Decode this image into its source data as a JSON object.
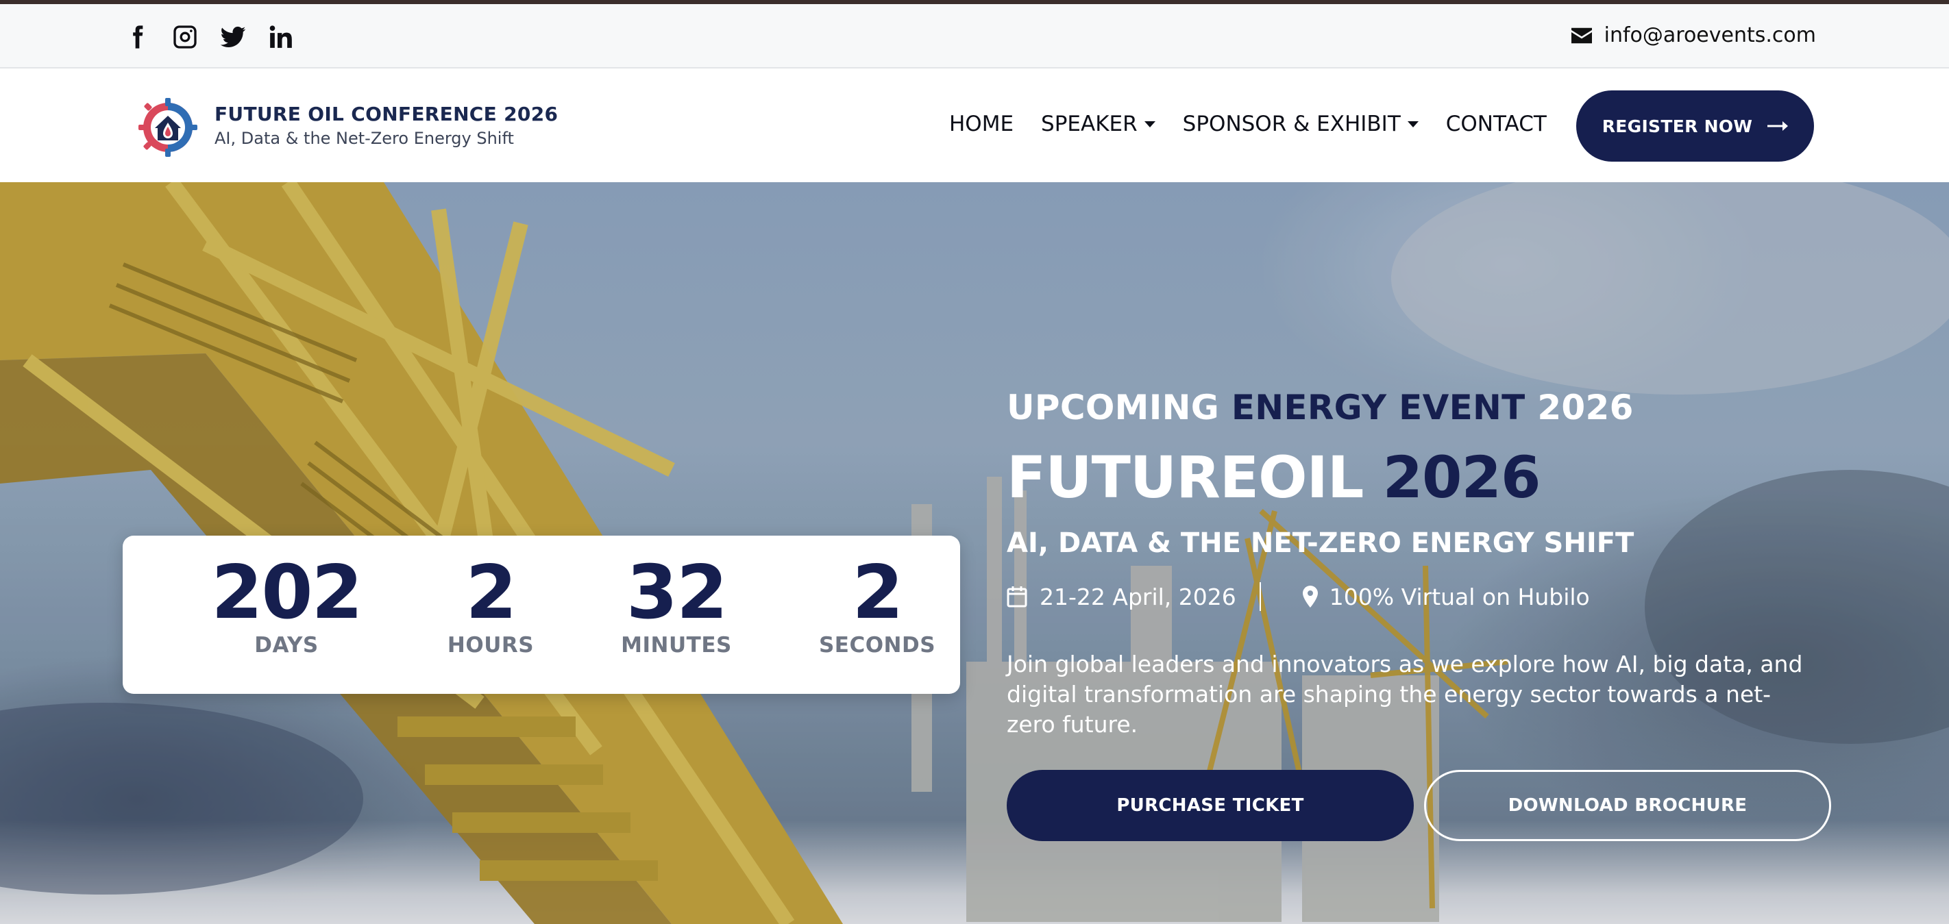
{
  "topbar": {
    "social": [
      "facebook-icon",
      "instagram-icon",
      "twitter-icon",
      "linkedin-icon"
    ],
    "email": "info@aroevents.com"
  },
  "navbar": {
    "brand_title": "FUTURE OIL CONFERENCE 2026",
    "brand_subtitle": "AI, Data & the Net-Zero Energy Shift",
    "menu": [
      {
        "label": "HOME",
        "dropdown": false
      },
      {
        "label": "SPEAKER",
        "dropdown": true
      },
      {
        "label": "SPONSOR & EXHIBIT",
        "dropdown": true
      },
      {
        "label": "CONTACT",
        "dropdown": false
      }
    ],
    "register_label": "REGISTER NOW"
  },
  "countdown": {
    "days": "202",
    "days_label": "DAYS",
    "hours": "2",
    "hours_label": "HOURS",
    "minutes": "32",
    "minutes_label": "MINUTES",
    "seconds": "2",
    "seconds_label": "SECONDS"
  },
  "hero": {
    "eyebrow_white": "UPCOMING",
    "eyebrow_navy": "ENERGY EVENT",
    "eyebrow_year": "2026",
    "title_white": "FUTUREOIL",
    "title_navy": "2026",
    "subtitle": "AI, DATA & THE NET-ZERO ENERGY SHIFT",
    "date": "21-22 April, 2026",
    "location": "100% Virtual on Hubilo",
    "description": "Join global leaders and innovators as we explore how AI, big data, and digital transformation are shaping the energy sector towards a net-zero future.",
    "primary_button": "PURCHASE TICKET",
    "secondary_button": "DOWNLOAD BROCHURE"
  },
  "colors": {
    "navy": "#161f4f",
    "white": "#ffffff",
    "label_gray": "#6f7684"
  }
}
